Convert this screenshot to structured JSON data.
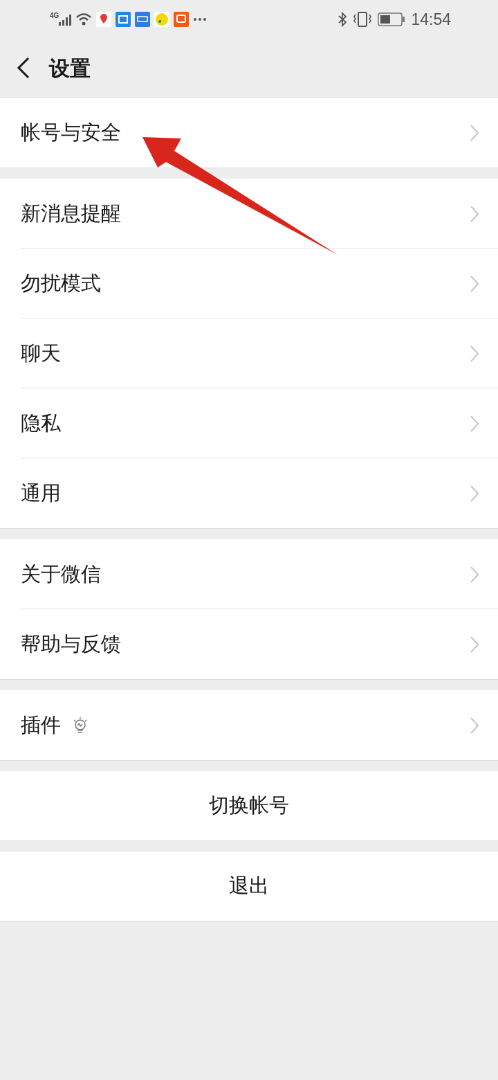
{
  "status_bar": {
    "network": "4G",
    "time": "14:54"
  },
  "header": {
    "title": "设置"
  },
  "groups": [
    {
      "items": [
        {
          "label": "帐号与安全",
          "kind": "link"
        }
      ]
    },
    {
      "items": [
        {
          "label": "新消息提醒",
          "kind": "link"
        },
        {
          "label": "勿扰模式",
          "kind": "link"
        },
        {
          "label": "聊天",
          "kind": "link"
        },
        {
          "label": "隐私",
          "kind": "link"
        },
        {
          "label": "通用",
          "kind": "link"
        }
      ]
    },
    {
      "items": [
        {
          "label": "关于微信",
          "kind": "link"
        },
        {
          "label": "帮助与反馈",
          "kind": "link"
        }
      ]
    },
    {
      "items": [
        {
          "label": "插件",
          "kind": "plugin"
        }
      ]
    }
  ],
  "actions": [
    "切换帐号",
    "退出"
  ]
}
